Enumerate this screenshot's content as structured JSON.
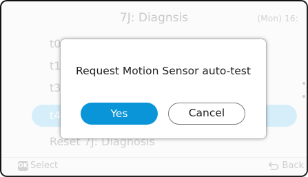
{
  "header": {
    "title": "7J: Diagnsis",
    "clock": "(Mon) 16:"
  },
  "list": {
    "items": [
      {
        "label": "t0"
      },
      {
        "label": "t1"
      },
      {
        "label": "t3"
      },
      {
        "label": "t4"
      }
    ],
    "reset_label": "Reset 7J: Diagnosis"
  },
  "dialog": {
    "message": "Request Motion Sensor auto-test",
    "yes_label": "Yes",
    "cancel_label": "Cancel"
  },
  "footer": {
    "ok_badge": "OK",
    "select_label": "Select",
    "back_label": "Back"
  },
  "colors": {
    "accent": "#0a95d8",
    "selected_row": "#d6eef9"
  }
}
